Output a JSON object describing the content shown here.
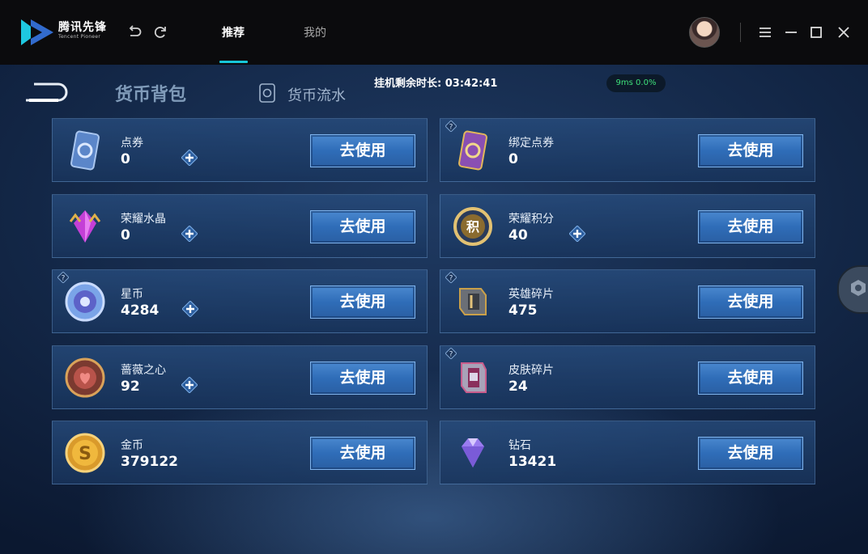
{
  "app": {
    "logo_cn": "腾讯先锋",
    "logo_en": "Tencent Pioneer",
    "tabs": [
      {
        "label": "推荐",
        "active": true
      },
      {
        "label": "我的",
        "active": false
      }
    ],
    "accent": "#17c6d9"
  },
  "game": {
    "section_title": "货币背包",
    "flow_tab": "货币流水",
    "timer": "挂机剩余时长: 03:42:41",
    "ping": "9ms  0.0%",
    "use_label": "去使用",
    "items": [
      {
        "name": "点券",
        "value": "0",
        "plus": true,
        "help": false,
        "icon": "coupon-card-icon"
      },
      {
        "name": "绑定点券",
        "value": "0",
        "plus": false,
        "help": true,
        "icon": "bound-coupon-card-icon"
      },
      {
        "name": "荣耀水晶",
        "value": "0",
        "plus": true,
        "help": false,
        "icon": "glory-crystal-icon"
      },
      {
        "name": "荣耀积分",
        "value": "40",
        "plus": true,
        "help": false,
        "icon": "glory-points-icon"
      },
      {
        "name": "星币",
        "value": "4284",
        "plus": true,
        "help": true,
        "icon": "star-coin-icon"
      },
      {
        "name": "英雄碎片",
        "value": "475",
        "plus": false,
        "help": true,
        "icon": "hero-fragment-icon"
      },
      {
        "name": "蔷薇之心",
        "value": "92",
        "plus": true,
        "help": false,
        "icon": "rose-heart-icon"
      },
      {
        "name": "皮肤碎片",
        "value": "24",
        "plus": false,
        "help": true,
        "icon": "skin-fragment-icon"
      },
      {
        "name": "金币",
        "value": "379122",
        "plus": false,
        "help": false,
        "icon": "gold-coin-icon"
      },
      {
        "name": "钻石",
        "value": "13421",
        "plus": false,
        "help": false,
        "icon": "diamond-icon"
      }
    ]
  }
}
